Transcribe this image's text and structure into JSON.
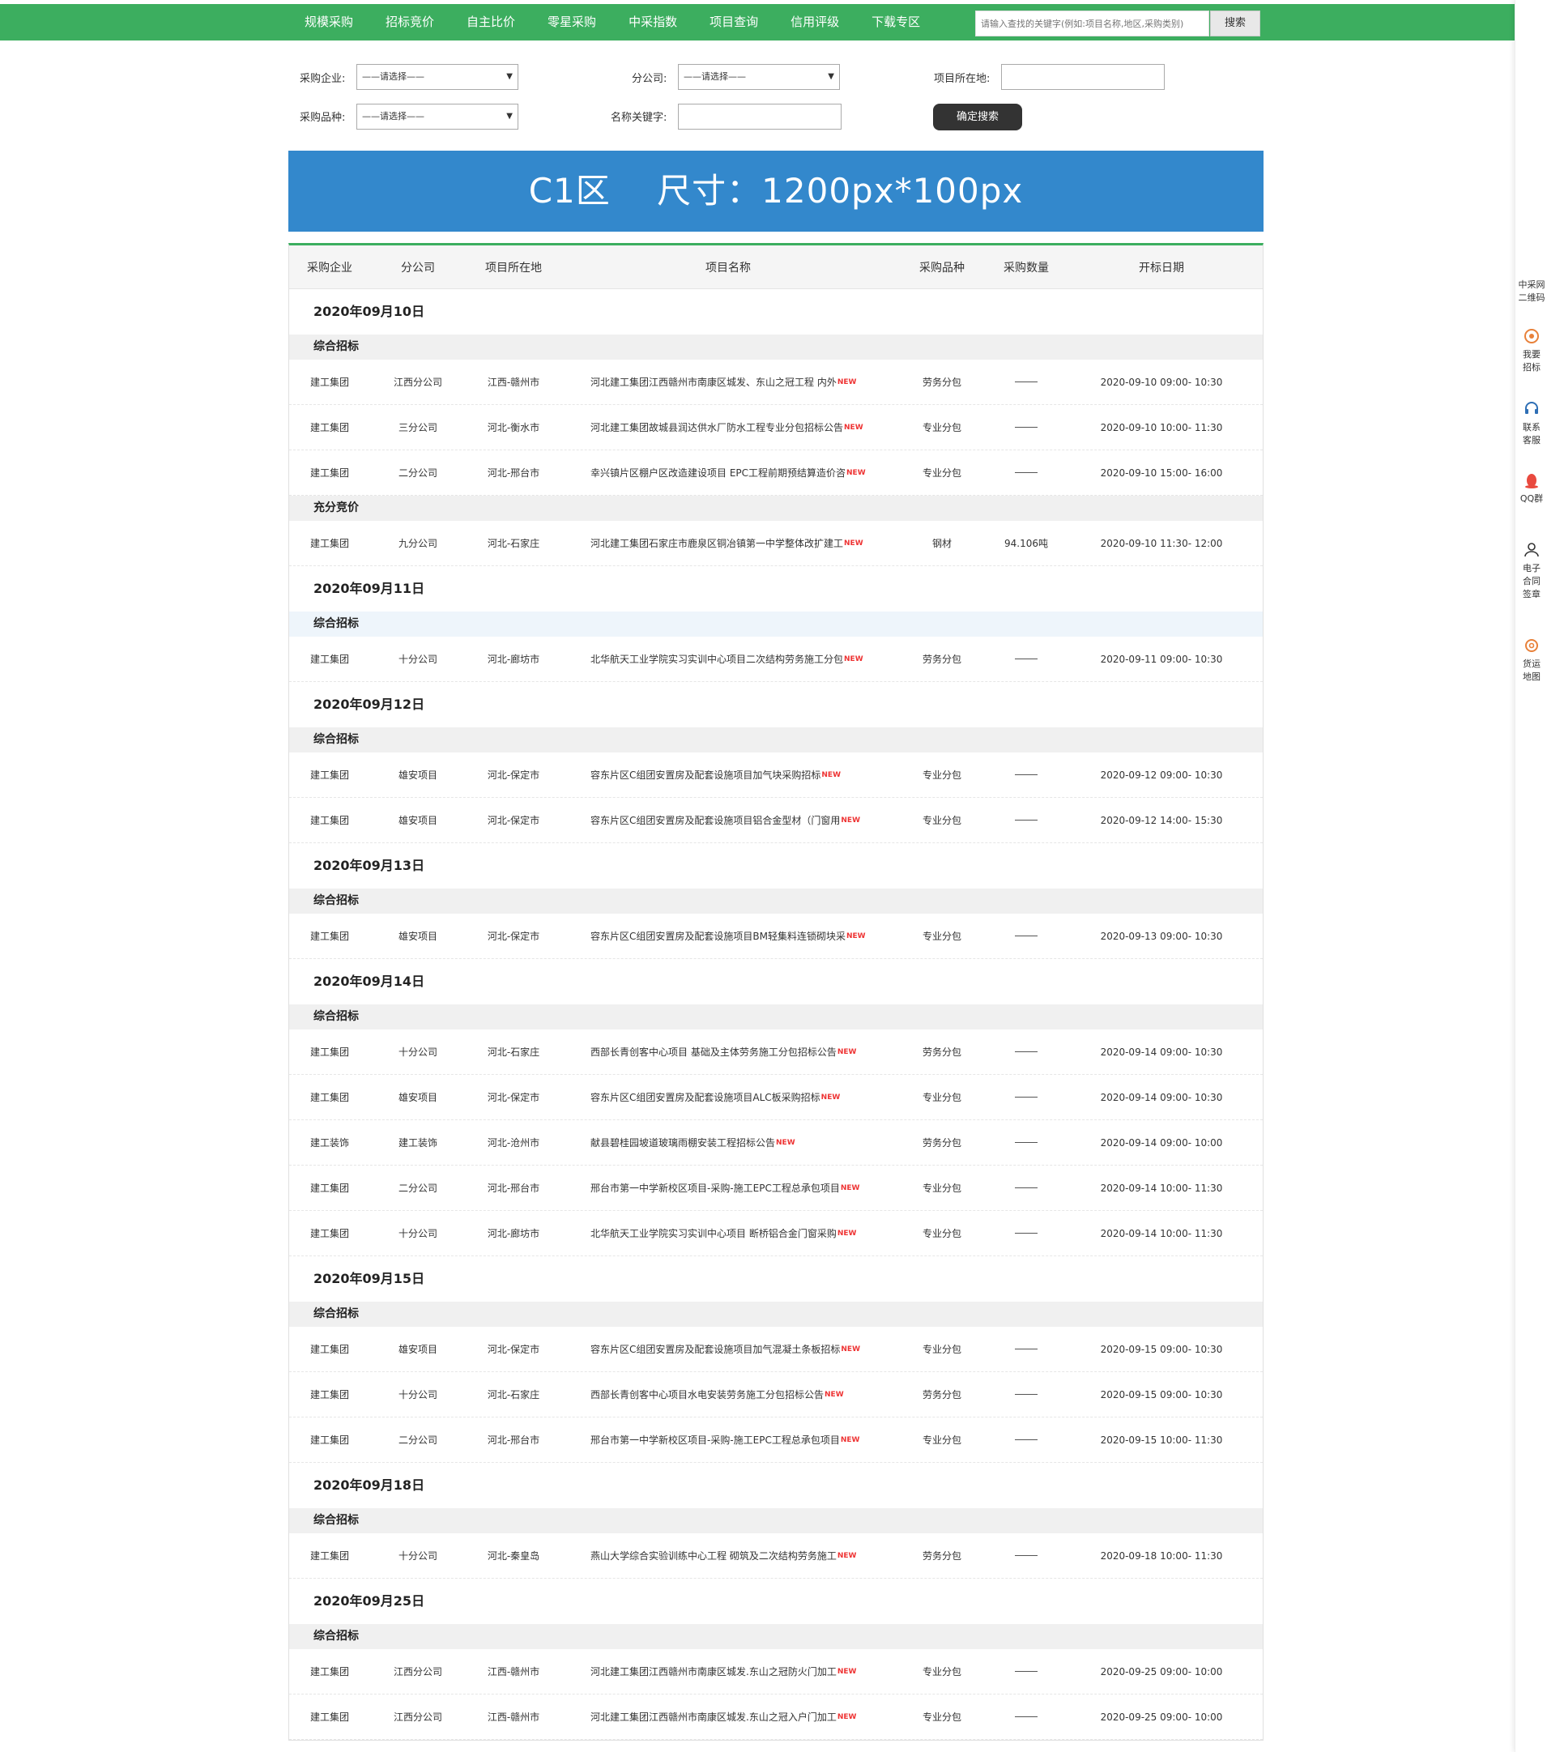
{
  "nav": {
    "items": [
      "规模采购",
      "招标竞价",
      "自主比价",
      "零星采购",
      "中采指数",
      "项目查询",
      "信用评级",
      "下载专区"
    ],
    "search_placeholder": "请输入查找的关键字(例如:项目名称,地区,采购类别)",
    "search_button": "搜索"
  },
  "filter": {
    "company_label": "采购企业:",
    "company_value": "——请选择——",
    "branch_label": "分公司:",
    "branch_value": "——请选择——",
    "location_label": "项目所在地:",
    "type_label": "采购品种:",
    "type_value": "——请选择——",
    "keyword_label": "名称关键字:",
    "submit": "确定搜索"
  },
  "banner": {
    "text": "C1区    尺寸：1200px*100px"
  },
  "table": {
    "headers": {
      "company": "采购企业",
      "branch": "分公司",
      "location": "项目所在地",
      "name": "项目名称",
      "type": "采购品种",
      "qty": "采购数量",
      "date": "开标日期"
    },
    "new_badge": "NEW",
    "groups": [
      {
        "date": "2020年09月10日",
        "cats": [
          {
            "name": "综合招标",
            "rows": [
              [
                "建工集团",
                "江西分公司",
                "江西-赣州市",
                "河北建工集团江西赣州市南康区城发、东山之冠工程 内外",
                "劳务分包",
                "",
                "2020-09-10 09:00- 10:30"
              ],
              [
                "建工集团",
                "三分公司",
                "河北-衡水市",
                "河北建工集团故城县润达供水厂防水工程专业分包招标公告",
                "专业分包",
                "",
                "2020-09-10 10:00- 11:30"
              ],
              [
                "建工集团",
                "二分公司",
                "河北-邢台市",
                "幸兴镇片区棚户区改造建设项目 EPC工程前期预结算造价咨",
                "专业分包",
                "",
                "2020-09-10 15:00- 16:00"
              ]
            ]
          },
          {
            "name": "充分竞价",
            "rows": [
              [
                "建工集团",
                "九分公司",
                "河北-石家庄",
                "河北建工集团石家庄市鹿泉区铜冶镇第一中学整体改扩建工",
                "钢材",
                "94.106吨",
                "2020-09-10 11:30- 12:00"
              ]
            ]
          }
        ]
      },
      {
        "date": "2020年09月11日",
        "cats": [
          {
            "name": "综合招标",
            "light": true,
            "rows": [
              [
                "建工集团",
                "十分公司",
                "河北-廊坊市",
                "北华航天工业学院实习实训中心项目二次结构劳务施工分包",
                "劳务分包",
                "",
                "2020-09-11 09:00- 10:30"
              ]
            ]
          }
        ]
      },
      {
        "date": "2020年09月12日",
        "cats": [
          {
            "name": "综合招标",
            "rows": [
              [
                "建工集团",
                "雄安项目",
                "河北-保定市",
                "容东片区C组团安置房及配套设施项目加气块采购招标",
                "专业分包",
                "",
                "2020-09-12 09:00- 10:30"
              ],
              [
                "建工集团",
                "雄安项目",
                "河北-保定市",
                "容东片区C组团安置房及配套设施项目铝合金型材（门窗用",
                "专业分包",
                "",
                "2020-09-12 14:00- 15:30"
              ]
            ]
          }
        ]
      },
      {
        "date": "2020年09月13日",
        "cats": [
          {
            "name": "综合招标",
            "rows": [
              [
                "建工集团",
                "雄安项目",
                "河北-保定市",
                "容东片区C组团安置房及配套设施项目BM轻集料连锁砌块采",
                "专业分包",
                "",
                "2020-09-13 09:00- 10:30"
              ]
            ]
          }
        ]
      },
      {
        "date": "2020年09月14日",
        "cats": [
          {
            "name": "综合招标",
            "rows": [
              [
                "建工集团",
                "十分公司",
                "河北-石家庄",
                "西部长青创客中心项目 基础及主体劳务施工分包招标公告",
                "劳务分包",
                "",
                "2020-09-14 09:00- 10:30"
              ],
              [
                "建工集团",
                "雄安项目",
                "河北-保定市",
                "容东片区C组团安置房及配套设施项目ALC板采购招标",
                "专业分包",
                "",
                "2020-09-14 09:00- 10:30"
              ],
              [
                "建工装饰",
                "建工装饰",
                "河北-沧州市",
                "献县碧桂园坡道玻璃雨棚安装工程招标公告",
                "劳务分包",
                "",
                "2020-09-14 09:00- 10:00"
              ],
              [
                "建工集团",
                "二分公司",
                "河北-邢台市",
                "邢台市第一中学新校区项目-采购-施工EPC工程总承包项目",
                "专业分包",
                "",
                "2020-09-14 10:00- 11:30"
              ],
              [
                "建工集团",
                "十分公司",
                "河北-廊坊市",
                "北华航天工业学院实习实训中心项目 断桥铝合金门窗采购",
                "专业分包",
                "",
                "2020-09-14 10:00- 11:30"
              ]
            ]
          }
        ]
      },
      {
        "date": "2020年09月15日",
        "cats": [
          {
            "name": "综合招标",
            "rows": [
              [
                "建工集团",
                "雄安项目",
                "河北-保定市",
                "容东片区C组团安置房及配套设施项目加气混凝土条板招标",
                "专业分包",
                "",
                "2020-09-15 09:00- 10:30"
              ],
              [
                "建工集团",
                "十分公司",
                "河北-石家庄",
                "西部长青创客中心项目水电安装劳务施工分包招标公告",
                "劳务分包",
                "",
                "2020-09-15 09:00- 10:30"
              ],
              [
                "建工集团",
                "二分公司",
                "河北-邢台市",
                "邢台市第一中学新校区项目-采购-施工EPC工程总承包项目",
                "专业分包",
                "",
                "2020-09-15 10:00- 11:30"
              ]
            ]
          }
        ]
      },
      {
        "date": "2020年09月18日",
        "cats": [
          {
            "name": "综合招标",
            "rows": [
              [
                "建工集团",
                "十分公司",
                "河北-秦皇岛",
                "燕山大学综合实验训练中心工程 砌筑及二次结构劳务施工",
                "劳务分包",
                "",
                "2020-09-18 10:00- 11:30"
              ]
            ]
          }
        ]
      },
      {
        "date": "2020年09月25日",
        "cats": [
          {
            "name": "综合招标",
            "rows": [
              [
                "建工集团",
                "江西分公司",
                "江西-赣州市",
                "河北建工集团江西赣州市南康区城发.东山之冠防火门加工",
                "专业分包",
                "",
                "2020-09-25 09:00- 10:00"
              ],
              [
                "建工集团",
                "江西分公司",
                "江西-赣州市",
                "河北建工集团江西赣州市南康区城发.东山之冠入户门加工",
                "专业分包",
                "",
                "2020-09-25 09:00- 10:00"
              ]
            ]
          }
        ]
      }
    ]
  },
  "sidebar": {
    "qr": "中采网二维码",
    "bid": "我要招标",
    "service": "联系客服",
    "qq": "QQ群",
    "contract": "电子合同签章",
    "freight": "货运地图"
  },
  "colors": {
    "nav": "#3cae5f",
    "banner": "#3388cc",
    "new": "#ee3333",
    "button": "#333333"
  }
}
